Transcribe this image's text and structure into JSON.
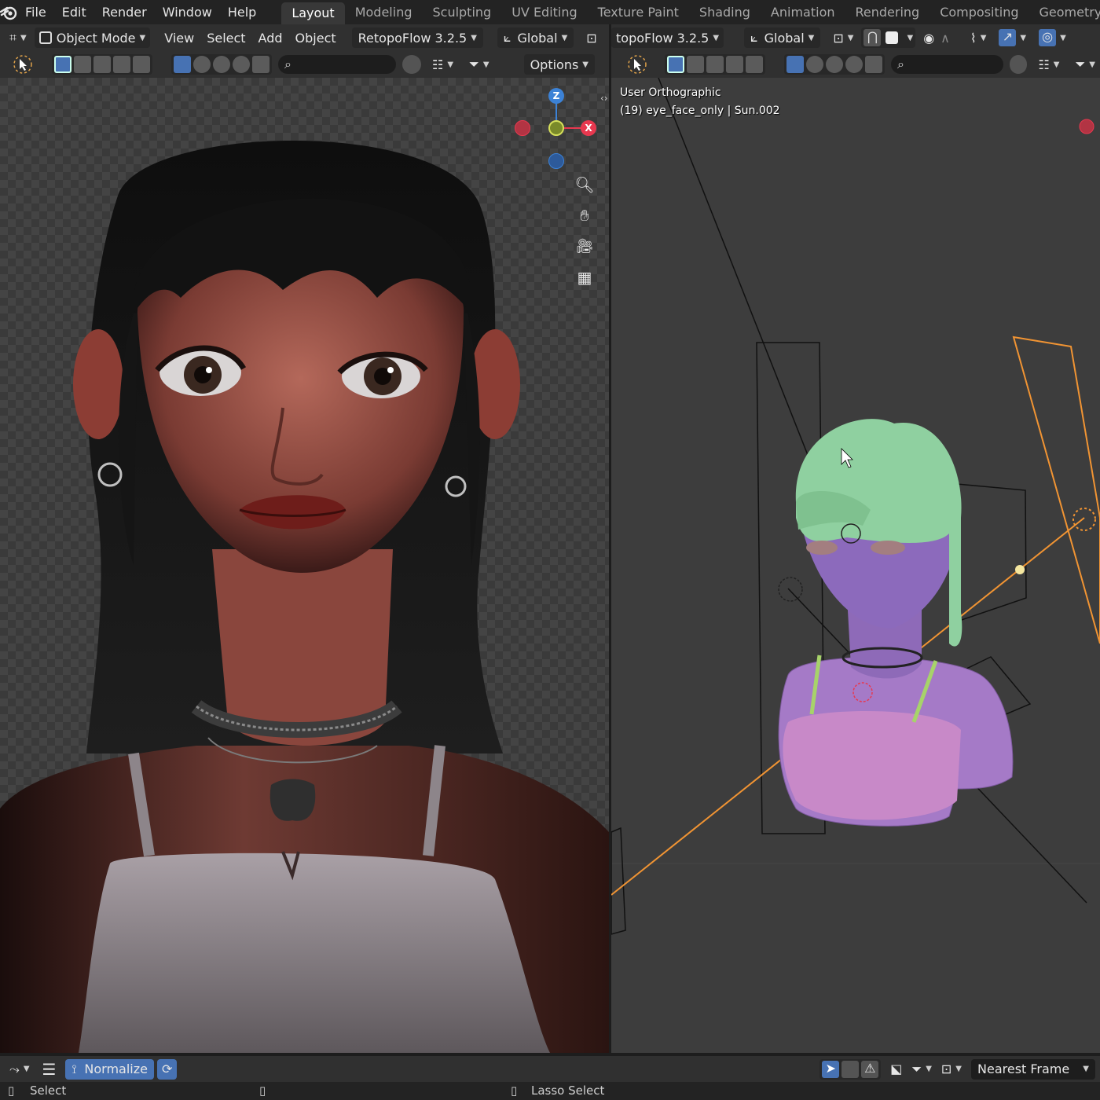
{
  "menu": {
    "items": [
      "File",
      "Edit",
      "Render",
      "Window",
      "Help"
    ]
  },
  "workspaces": {
    "active": "Layout",
    "tabs": [
      "Layout",
      "Modeling",
      "Sculpting",
      "UV Editing",
      "Texture Paint",
      "Shading",
      "Animation",
      "Rendering",
      "Compositing",
      "Geometry Node"
    ]
  },
  "left_header": {
    "mode": "Object Mode",
    "view": "View",
    "select": "Select",
    "add": "Add",
    "object": "Object",
    "addon": "RetopoFlow 3.2.5",
    "orientation": "Global"
  },
  "right_header": {
    "addon": "topoFlow 3.2.5",
    "orientation": "Global"
  },
  "left_tools": {
    "options_label": "Options"
  },
  "right_overlay": {
    "view_name": "User Orthographic",
    "object_info": "(19) eye_face_only | Sun.002"
  },
  "gizmo": {
    "z": "Z",
    "x": "X"
  },
  "timeline": {
    "normalize_label": "Normalize",
    "frame_mode": "Nearest Frame"
  },
  "status": {
    "select": "Select",
    "lasso": "Lasso Select"
  },
  "colors": {
    "accent_blue": "#4772b3",
    "x_axis": "#e8384f",
    "y_axis": "#7fbf3f",
    "z_axis": "#3c82d6",
    "selected_orange": "#f19433"
  }
}
